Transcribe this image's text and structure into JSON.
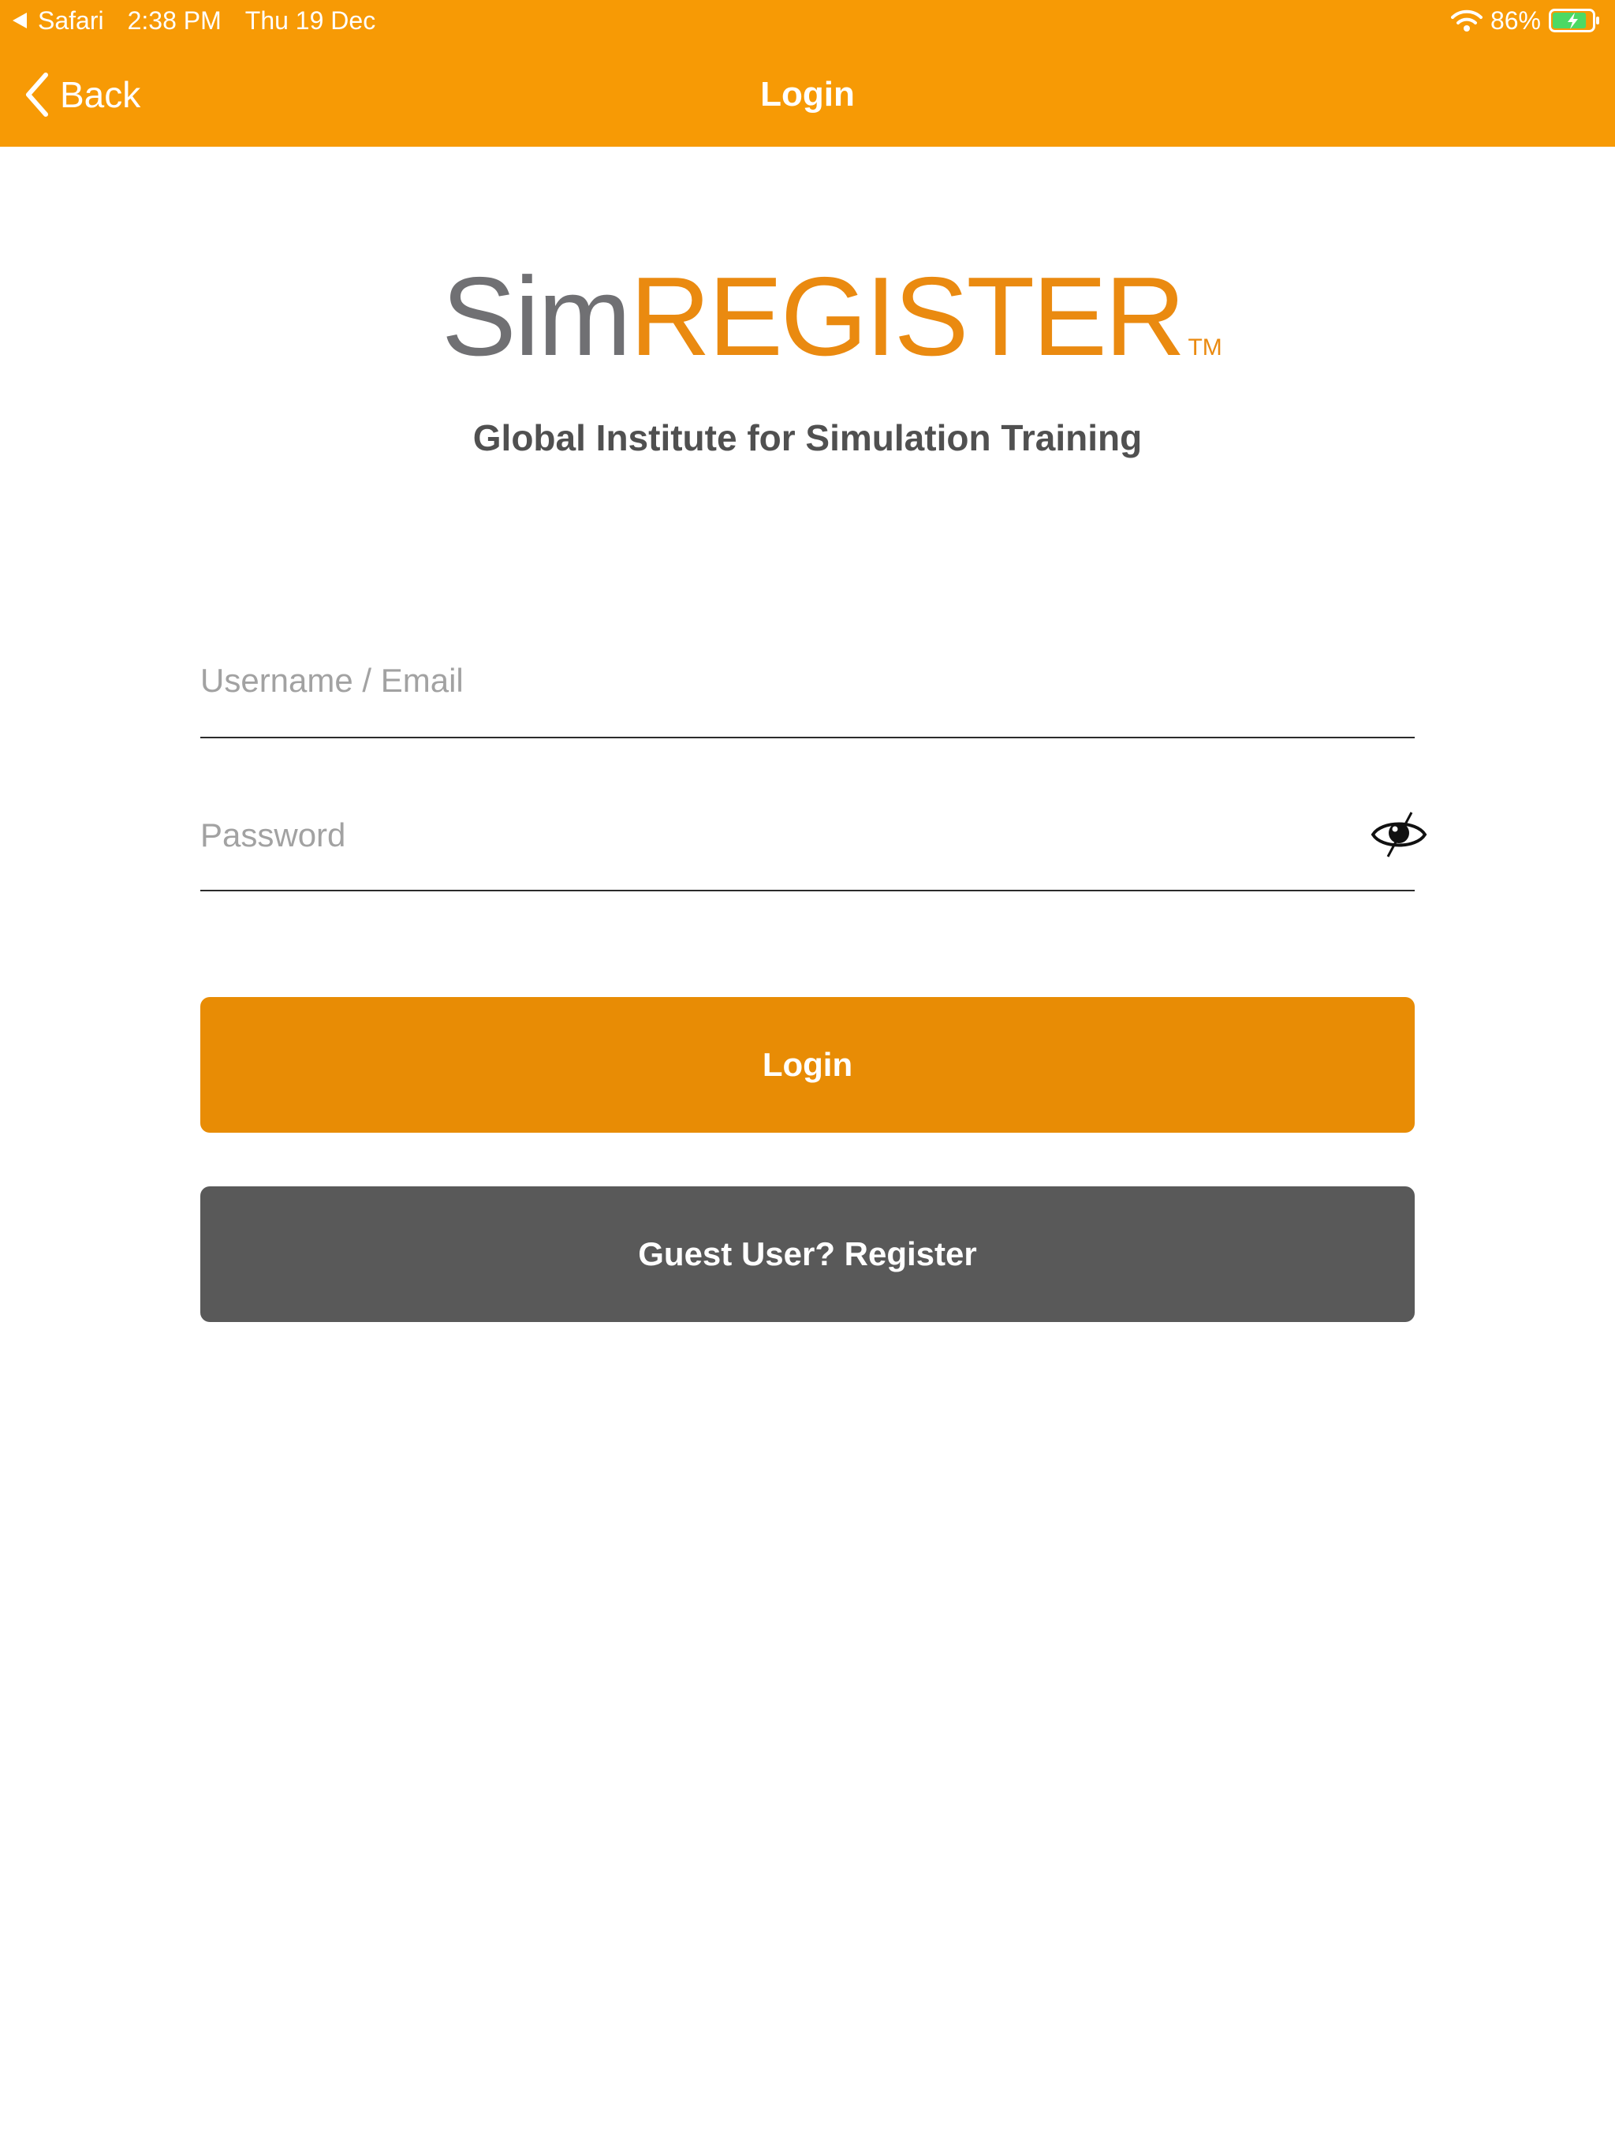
{
  "status_bar": {
    "back_app": "Safari",
    "time": "2:38 PM",
    "date": "Thu 19 Dec",
    "battery_percent": "86%",
    "battery_level": 0.86,
    "charging": true
  },
  "nav": {
    "back_label": "Back",
    "title": "Login"
  },
  "logo": {
    "sim": "Sim",
    "register": "REGISTER",
    "tm": "TM"
  },
  "tagline": "Global Institute for Simulation Training",
  "form": {
    "username_placeholder": "Username / Email",
    "username_value": "",
    "password_placeholder": "Password",
    "password_value": ""
  },
  "buttons": {
    "login_label": "Login",
    "register_label": "Guest User? Register"
  },
  "colors": {
    "header": "#f79a05",
    "login_button": "#e88c05",
    "register_button": "#595959",
    "logo_gray": "#707073",
    "logo_orange": "#ea8a10",
    "battery_fill": "#4cd964"
  },
  "icons": {
    "status_back": "back-triangle-icon",
    "wifi": "wifi-icon",
    "battery": "battery-charging-icon",
    "back": "chevron-left-icon",
    "password_toggle": "eye-slash-icon"
  }
}
